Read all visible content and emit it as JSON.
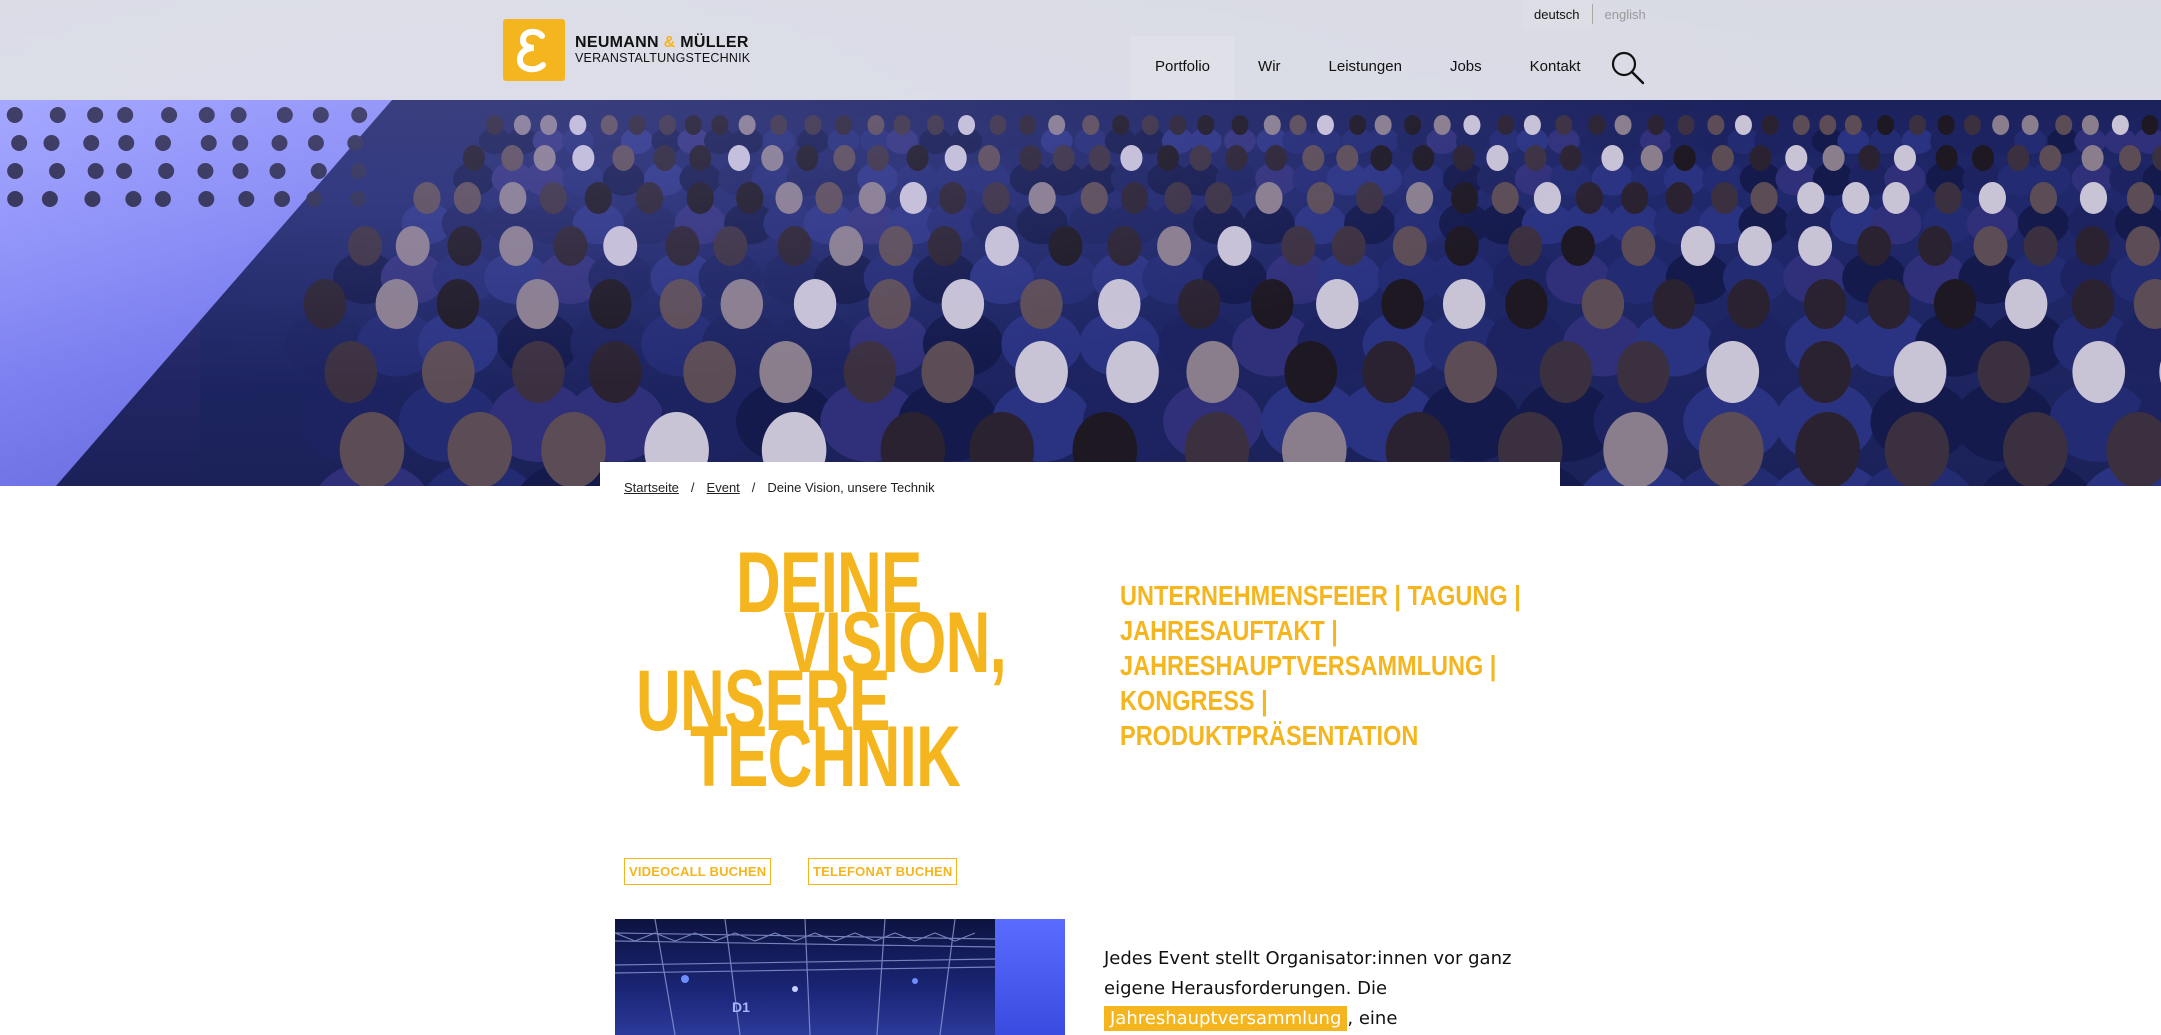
{
  "header": {
    "logo": {
      "line1_a": "NEUMANN",
      "amp": "&",
      "line1_b": "MÜLLER",
      "line2": "VERANSTALTUNGSTECHNIK"
    },
    "languages": [
      {
        "label": "deutsch",
        "active": true
      },
      {
        "label": "english",
        "active": false
      }
    ],
    "nav": [
      {
        "label": "Portfolio",
        "active": true
      },
      {
        "label": "Wir",
        "active": false
      },
      {
        "label": "Leistungen",
        "active": false
      },
      {
        "label": "Jobs",
        "active": false
      },
      {
        "label": "Kontakt",
        "active": false
      }
    ],
    "search_icon": "search-icon"
  },
  "breadcrumb": {
    "items": [
      "Startseite",
      "Event",
      "Deine Vision, unsere Technik"
    ],
    "separator": "/"
  },
  "headline": {
    "line1": "DEINE",
    "line2": "VISION,",
    "line3": "UNSERE",
    "line4": "TECHNIK"
  },
  "event_types": "Unternehmensfeier | Tagung | Jahresauftakt | Jahreshauptversammlung | Kongress | Produktpräsentation",
  "cta": {
    "videocall": "VIDEOCALL BUCHEN",
    "telefonat": "TELEFONAT BUCHEN"
  },
  "stage_photo": {
    "label": "D1"
  },
  "intro": {
    "before": "Jedes Event stellt Organisator:innen vor ganz eigene Herausforderungen. Die ",
    "highlight": "Jahreshauptversammlung",
    "after": ", eine"
  },
  "colors": {
    "accent": "#f5b51e",
    "header_bg": "#e8e9f0",
    "text": "#111111"
  }
}
